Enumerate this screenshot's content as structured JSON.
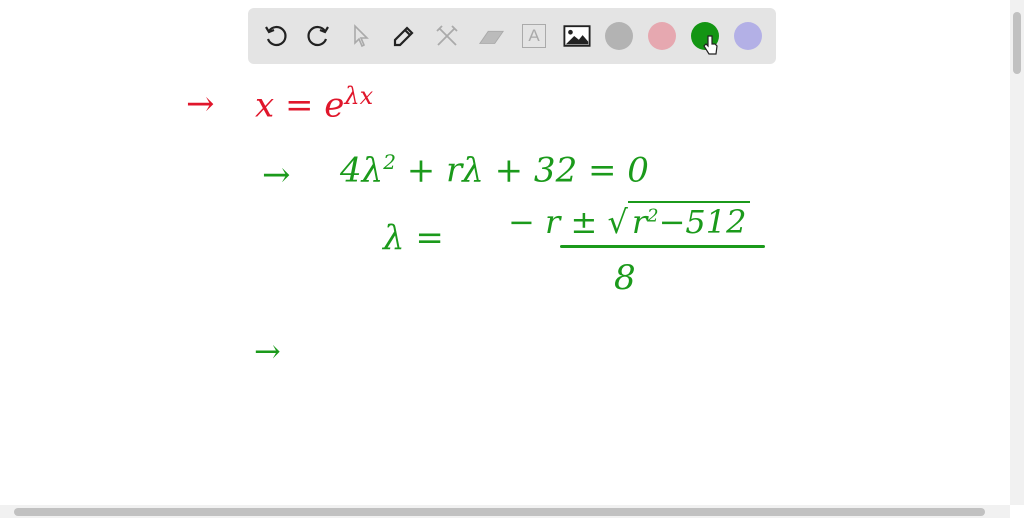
{
  "toolbar": {
    "tools": [
      "undo",
      "redo",
      "select",
      "pen",
      "tools",
      "eraser",
      "text",
      "image"
    ],
    "colors": [
      "#b3b3b3",
      "#e6a8b0",
      "#139513",
      "#b3b0e6"
    ],
    "selected_color": "#139513",
    "text_tool_glyph": "A"
  },
  "canvas": {
    "line1": {
      "arrow": "→",
      "expr": "x = e",
      "sup": "λx",
      "color": "#e0162b"
    },
    "line2": {
      "arrow": "→",
      "expr": "4λ",
      "sup": "2",
      "rest": "+ rλ + 32 = 0"
    },
    "line3": {
      "lhs": "λ  =",
      "num_a": "− r ±",
      "num_b": "r",
      "num_sup": "2",
      "num_c": "−512",
      "den": "8"
    },
    "line4": {
      "arrow": "→"
    },
    "ink_color": "#1b9a1b"
  }
}
